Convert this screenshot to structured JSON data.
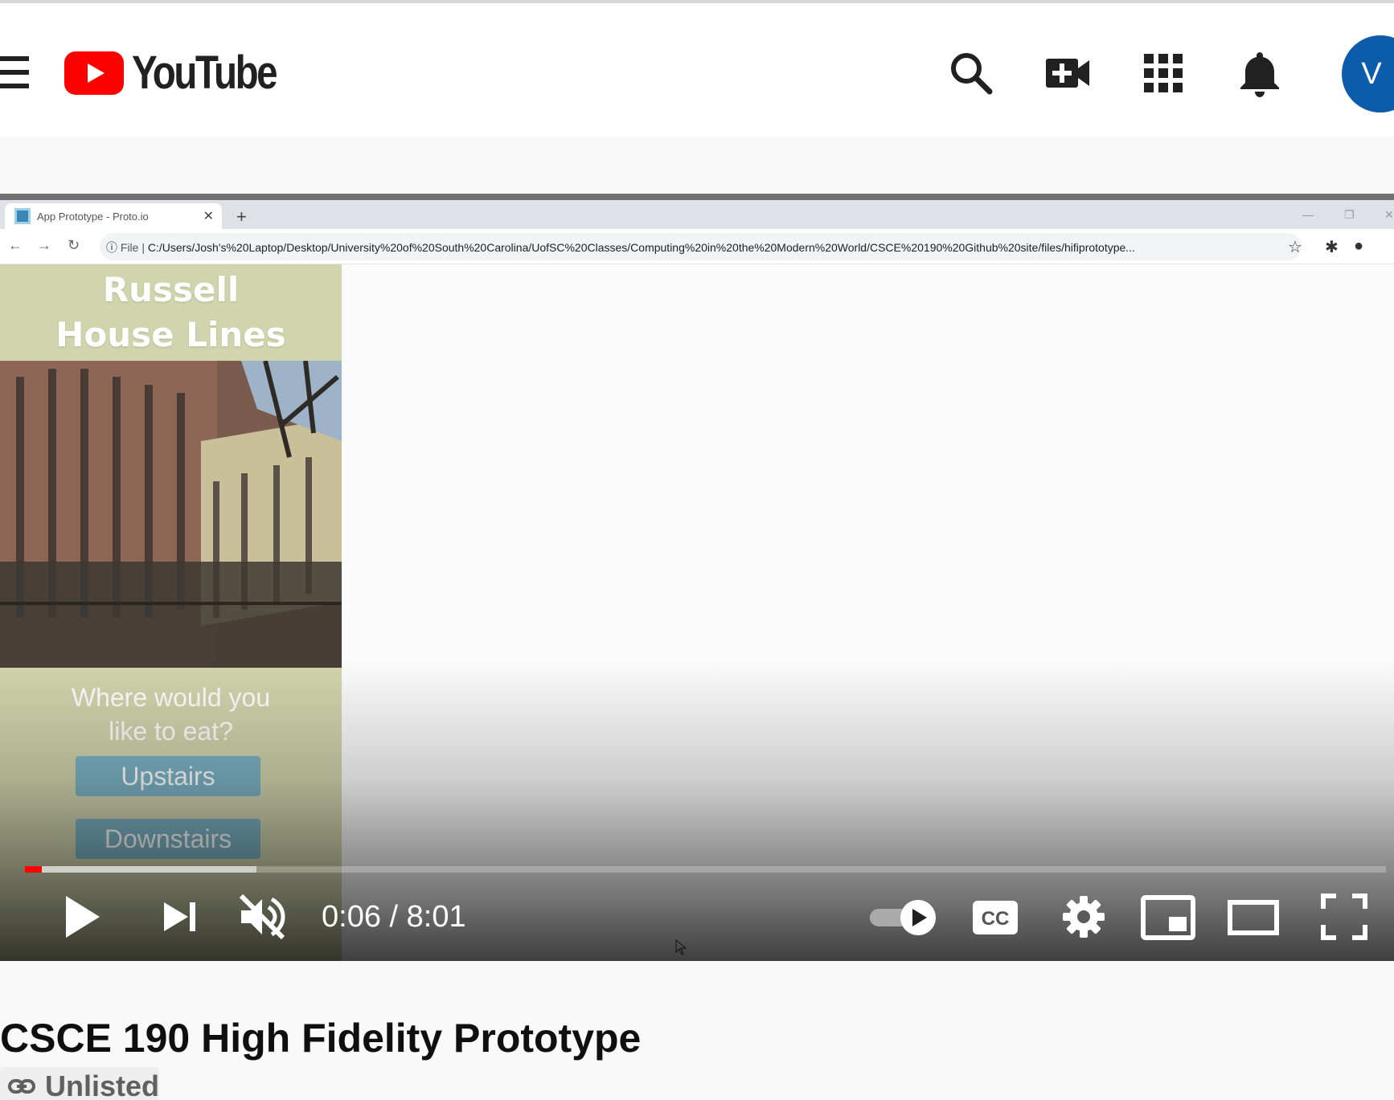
{
  "masthead": {
    "logo_text": "YouTube",
    "avatar_letter": "V",
    "brand_red": "#ff0000",
    "avatar_color": "#0d5cab",
    "icons": [
      "menu-icon",
      "search-icon",
      "create-video-icon",
      "apps-grid-icon",
      "notifications-bell-icon"
    ]
  },
  "recording": {
    "tab_title": "App Prototype - Proto.io",
    "file_label": "File |",
    "url": "C:/Users/Josh's%20Laptop/Desktop/University%20of%20South%20Carolina/UofSC%20Classes/Computing%20in%20the%20Modern%20World/CSCE%20190%20Github%20site/files/hifiprototype..."
  },
  "prototype": {
    "title_line1": "Russell",
    "title_line2": "House Lines",
    "question_line1": "Where would you",
    "question_line2": "like to eat?",
    "button_upstairs": "Upstairs",
    "button_downstairs": "Downstairs"
  },
  "player": {
    "time_current": "0:06",
    "time_separator": " / ",
    "time_total": "8:01",
    "played_fraction": 0.0125,
    "buffered_fraction": 0.17,
    "autoplay_on": true,
    "muted": true,
    "cc_label": "CC"
  },
  "video": {
    "title": "CSCE 190 High Fidelity Prototype",
    "visibility": "Unlisted"
  }
}
